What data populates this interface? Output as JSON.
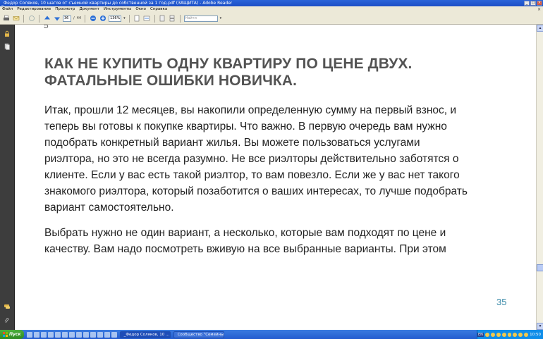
{
  "window": {
    "title": "_Федор Соляков, 10 шагов от съемной квартиры до  собственной за 1 год.pdf (ЗАЩИТА) - Adobe Reader",
    "min": "_",
    "max": "□",
    "close": "×"
  },
  "menu": {
    "items": [
      "Файл",
      "Редактирование",
      "Просмотр",
      "Документ",
      "Инструменты",
      "Окно",
      "Справка"
    ],
    "close": "×"
  },
  "toolbar": {
    "page_current": "36",
    "page_separator": "/",
    "page_total": "44",
    "zoom": "136%",
    "search_placeholder": "Найти"
  },
  "document": {
    "top_fragment": "5",
    "heading_line1": "КАК НЕ КУПИТЬ ОДНУ КВАРТИРУ ПО ЦЕНЕ ДВУХ.",
    "heading_line2": "ФАТАЛЬНЫЕ ОШИБКИ НОВИЧКА.",
    "para1_lines": [
      "Итак, прошли 12 месяцев, вы накопили определенную сумму на первый взнос, и",
      "теперь вы готовы к покупке квартиры. Что важно. В первую очередь вам нужно",
      "подобрать конкретный вариант жилья. Вы можете пользоваться услугами",
      "риэлтора,  но это не всегда разумно. Не все риэлторы действительно заботятся о",
      "клиенте. Если у вас есть такой риэлтор, то вам повезло. Если же у вас нет такого",
      "знакомого риэлтора, который позаботится о ваших интересах, то лучше подобрать",
      "вариант самостоятельно."
    ],
    "para2_lines": [
      "Выбрать нужно не один вариант,  а несколько, которые вам подходят по цене и",
      "качеству. Вам надо посмотреть вживую на все выбранные варианты. При этом"
    ],
    "page_number": "35"
  },
  "taskbar": {
    "start_label": "Пуск",
    "tasks": [
      {
        "label": "_Федор Соляков, 10 ..."
      },
      {
        "label": "Сообщество \"Семейны..."
      }
    ],
    "lang": "EN",
    "clock": "10:50"
  },
  "colors": {
    "heading": "#535353",
    "page_number": "#3a8aa8",
    "titlebar": "#2a63d8",
    "left_panel": "#3d3d3d"
  }
}
